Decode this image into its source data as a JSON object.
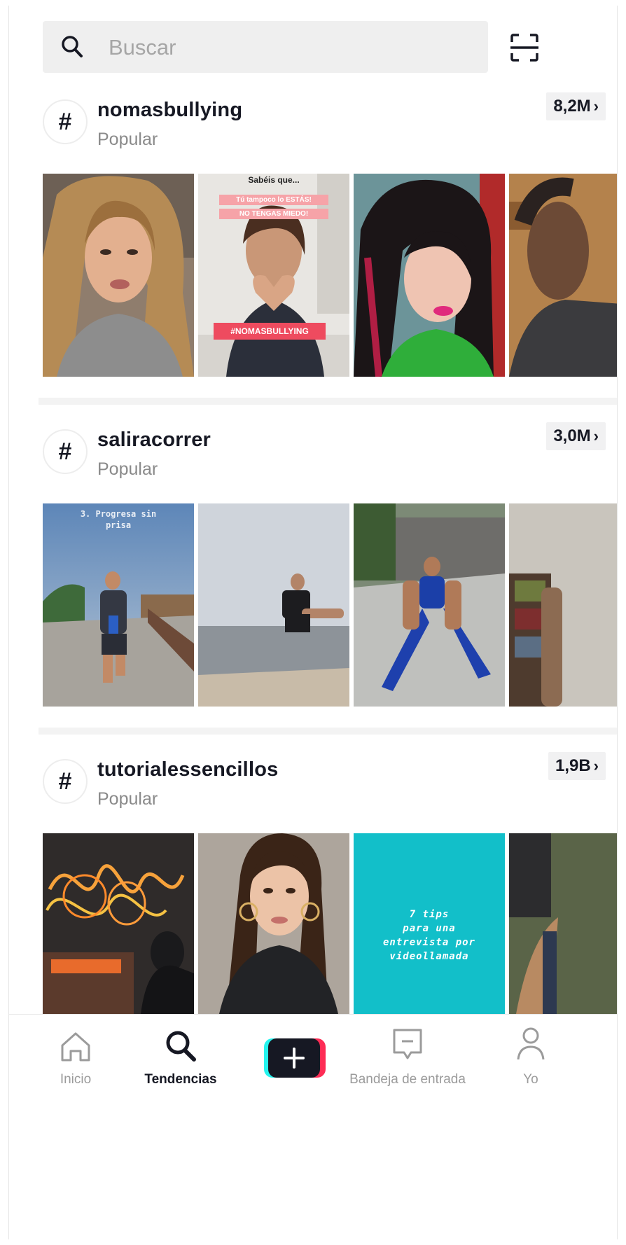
{
  "search": {
    "placeholder": "Buscar"
  },
  "sections": [
    {
      "tag": "nomasbullying",
      "subtitle": "Popular",
      "count": "8,2M",
      "overlay": {
        "title": "Sabéis que...",
        "line1": "Tú tampoco lo ESTÁS!",
        "line2": "NO TENGAS MIEDO!",
        "hashtag": "#NOMASBULLYING"
      }
    },
    {
      "tag": "saliracorrer",
      "subtitle": "Popular",
      "count": "3,0M",
      "overlay": {
        "line1": "3. Progresa sin",
        "line2": "prisa"
      }
    },
    {
      "tag": "tutorialessencillos",
      "subtitle": "Popular",
      "count": "1,9B",
      "overlay": {
        "line1": "7 tips",
        "line2": "para una",
        "line3": "entrevista por",
        "line4": "videollamada"
      }
    }
  ],
  "nav": {
    "home": "Inicio",
    "discover": "Tendencias",
    "inbox": "Bandeja de entrada",
    "profile": "Yo"
  },
  "icons": {
    "search": "search-icon",
    "scan": "scan-icon",
    "hashtag": "hashtag-icon",
    "chevron": "chevron-right-icon",
    "home": "home-icon",
    "discover": "search-icon",
    "create": "plus-icon",
    "inbox": "inbox-icon",
    "profile": "person-icon"
  },
  "colors": {
    "text": "#161823",
    "muted": "#8a8a8a",
    "accent_pink": "#fe2c55",
    "accent_cyan": "#25f4ee",
    "overlay_teal": "#12bfc9"
  }
}
